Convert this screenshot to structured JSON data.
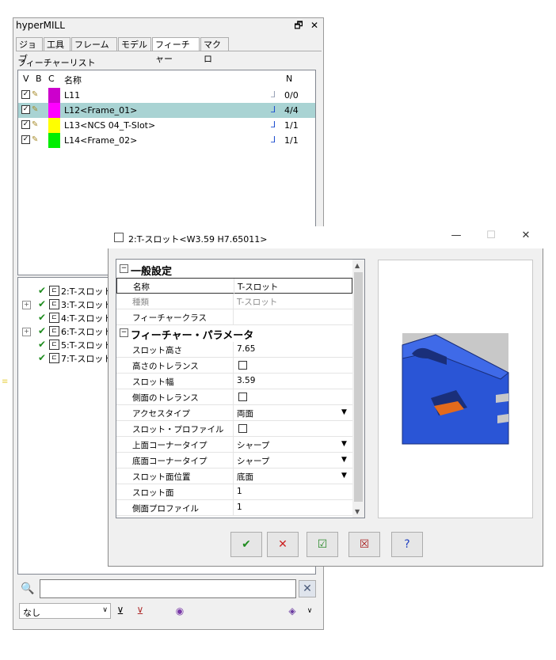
{
  "app": {
    "title": "hyperMILL"
  },
  "tabs": [
    "ジョブ",
    "工具",
    "フレーム",
    "モデル",
    "フィーチャー",
    "マクロ"
  ],
  "feature_list": {
    "label": "フィーチャーリスト",
    "headers": {
      "v": "V",
      "b": "B",
      "c": "C",
      "name": "名称",
      "n": "N"
    },
    "rows": [
      {
        "name": "L11",
        "count": "0/0",
        "color": "#cc00cc",
        "selected": false
      },
      {
        "name": "L12<Frame_01>",
        "count": "4/4",
        "color": "#ff00ff",
        "selected": true
      },
      {
        "name": "L13<NCS 04_T-Slot>",
        "count": "1/1",
        "color": "#ffff00",
        "selected": false
      },
      {
        "name": "L14<Frame_02>",
        "count": "1/1",
        "color": "#00ee00",
        "selected": false
      }
    ]
  },
  "tree": {
    "items": [
      {
        "label": "2:T-スロット<",
        "expandable": false
      },
      {
        "label": "3:T-スロット<",
        "expandable": true
      },
      {
        "label": "4:T-スロット<",
        "expandable": false
      },
      {
        "label": "6:T-スロット<",
        "expandable": true
      },
      {
        "label": "5:T-スロット<",
        "expandable": false
      },
      {
        "label": "7:T-スロット<",
        "expandable": false
      }
    ]
  },
  "bottom": {
    "filter_value": "なし",
    "search_value": ""
  },
  "dialog": {
    "title": "2:T-スロット<W3.59 H7.65011>",
    "sections": [
      {
        "title": "一般設定",
        "rows": [
          {
            "name": "名称",
            "value": "T-スロット",
            "kind": "text",
            "disabled": false
          },
          {
            "name": "種類",
            "value": "T-スロット",
            "kind": "text",
            "disabled": true
          },
          {
            "name": "フィーチャークラス",
            "value": "",
            "kind": "text",
            "disabled": false
          }
        ]
      },
      {
        "title": "フィーチャー・パラメータ",
        "rows": [
          {
            "name": "スロット高さ",
            "value": "7.65",
            "kind": "text",
            "disabled": false
          },
          {
            "name": "高さのトレランス",
            "value": "",
            "kind": "check",
            "disabled": false
          },
          {
            "name": "スロット幅",
            "value": "3.59",
            "kind": "text",
            "disabled": false
          },
          {
            "name": "側面のトレランス",
            "value": "",
            "kind": "check",
            "disabled": false
          },
          {
            "name": "アクセスタイプ",
            "value": "両面",
            "kind": "drop",
            "disabled": false
          },
          {
            "name": "スロット・プロファイル",
            "value": "",
            "kind": "check",
            "disabled": false
          },
          {
            "name": "上面コーナータイプ",
            "value": "シャープ",
            "kind": "drop",
            "disabled": false
          },
          {
            "name": "底面コーナータイプ",
            "value": "シャープ",
            "kind": "drop",
            "disabled": false
          },
          {
            "name": "スロット面位置",
            "value": "底面",
            "kind": "drop",
            "disabled": false
          },
          {
            "name": "スロット面",
            "value": "1",
            "kind": "text",
            "disabled": false
          },
          {
            "name": "側面プロファイル",
            "value": "1",
            "kind": "text",
            "disabled": false
          }
        ]
      }
    ],
    "buttons": [
      {
        "name": "ok-button",
        "icon": "check-icon",
        "glyph": "✔",
        "color": "#1f8c1f"
      },
      {
        "name": "cancel-button",
        "icon": "cross-icon",
        "glyph": "✕",
        "color": "#cc2020"
      },
      {
        "name": "apply-button",
        "icon": "apply-icon",
        "glyph": "☑",
        "color": "#2a8a2a"
      },
      {
        "name": "discard-button",
        "icon": "discard-icon",
        "glyph": "☒",
        "color": "#aa2020"
      },
      {
        "name": "help-button",
        "icon": "help-icon",
        "glyph": "?",
        "color": "#2040c0"
      }
    ]
  },
  "colors": {
    "selection": "#a9d3d3",
    "part_blue": "#2a55d6",
    "slot_orange": "#e36a1c"
  }
}
